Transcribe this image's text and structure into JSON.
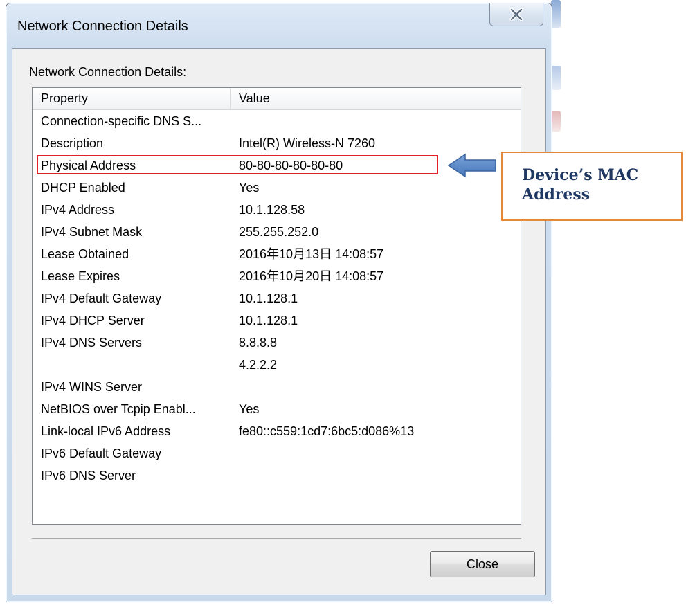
{
  "window": {
    "title": "Network Connection Details",
    "close_icon": "close-x-icon"
  },
  "group_label": "Network Connection Details:",
  "columns": {
    "property": "Property",
    "value": "Value"
  },
  "rows": [
    {
      "property": "Connection-specific DNS S...",
      "value": ""
    },
    {
      "property": "Description",
      "value": "Intel(R) Wireless-N 7260"
    },
    {
      "property": "Physical Address",
      "value": "80-80-80-80-80-80",
      "highlighted": true
    },
    {
      "property": "DHCP Enabled",
      "value": "Yes"
    },
    {
      "property": "IPv4 Address",
      "value": "10.1.128.58"
    },
    {
      "property": "IPv4 Subnet Mask",
      "value": "255.255.252.0"
    },
    {
      "property": "Lease Obtained",
      "value": "2016年10月13日 14:08:57"
    },
    {
      "property": "Lease Expires",
      "value": "2016年10月20日 14:08:57"
    },
    {
      "property": "IPv4 Default Gateway",
      "value": "10.1.128.1"
    },
    {
      "property": "IPv4 DHCP Server",
      "value": "10.1.128.1"
    },
    {
      "property": "IPv4 DNS Servers",
      "value": "8.8.8.8"
    },
    {
      "property": "",
      "value": "4.2.2.2"
    },
    {
      "property": "IPv4 WINS Server",
      "value": ""
    },
    {
      "property": "NetBIOS over Tcpip Enabl...",
      "value": "Yes"
    },
    {
      "property": "Link-local IPv6 Address",
      "value": "fe80::c559:1cd7:6bc5:d086%13"
    },
    {
      "property": "IPv6 Default Gateway",
      "value": ""
    },
    {
      "property": "IPv6 DNS Server",
      "value": ""
    }
  ],
  "close_button_label": "Close",
  "annotation": {
    "text": "Device’s MAC\nAddress",
    "arrow_icon": "left-arrow-icon",
    "text_color": "#1f3864",
    "border_color": "#e2893b",
    "arrow_color": "#4f81bd",
    "highlight_color": "#e0202a"
  }
}
